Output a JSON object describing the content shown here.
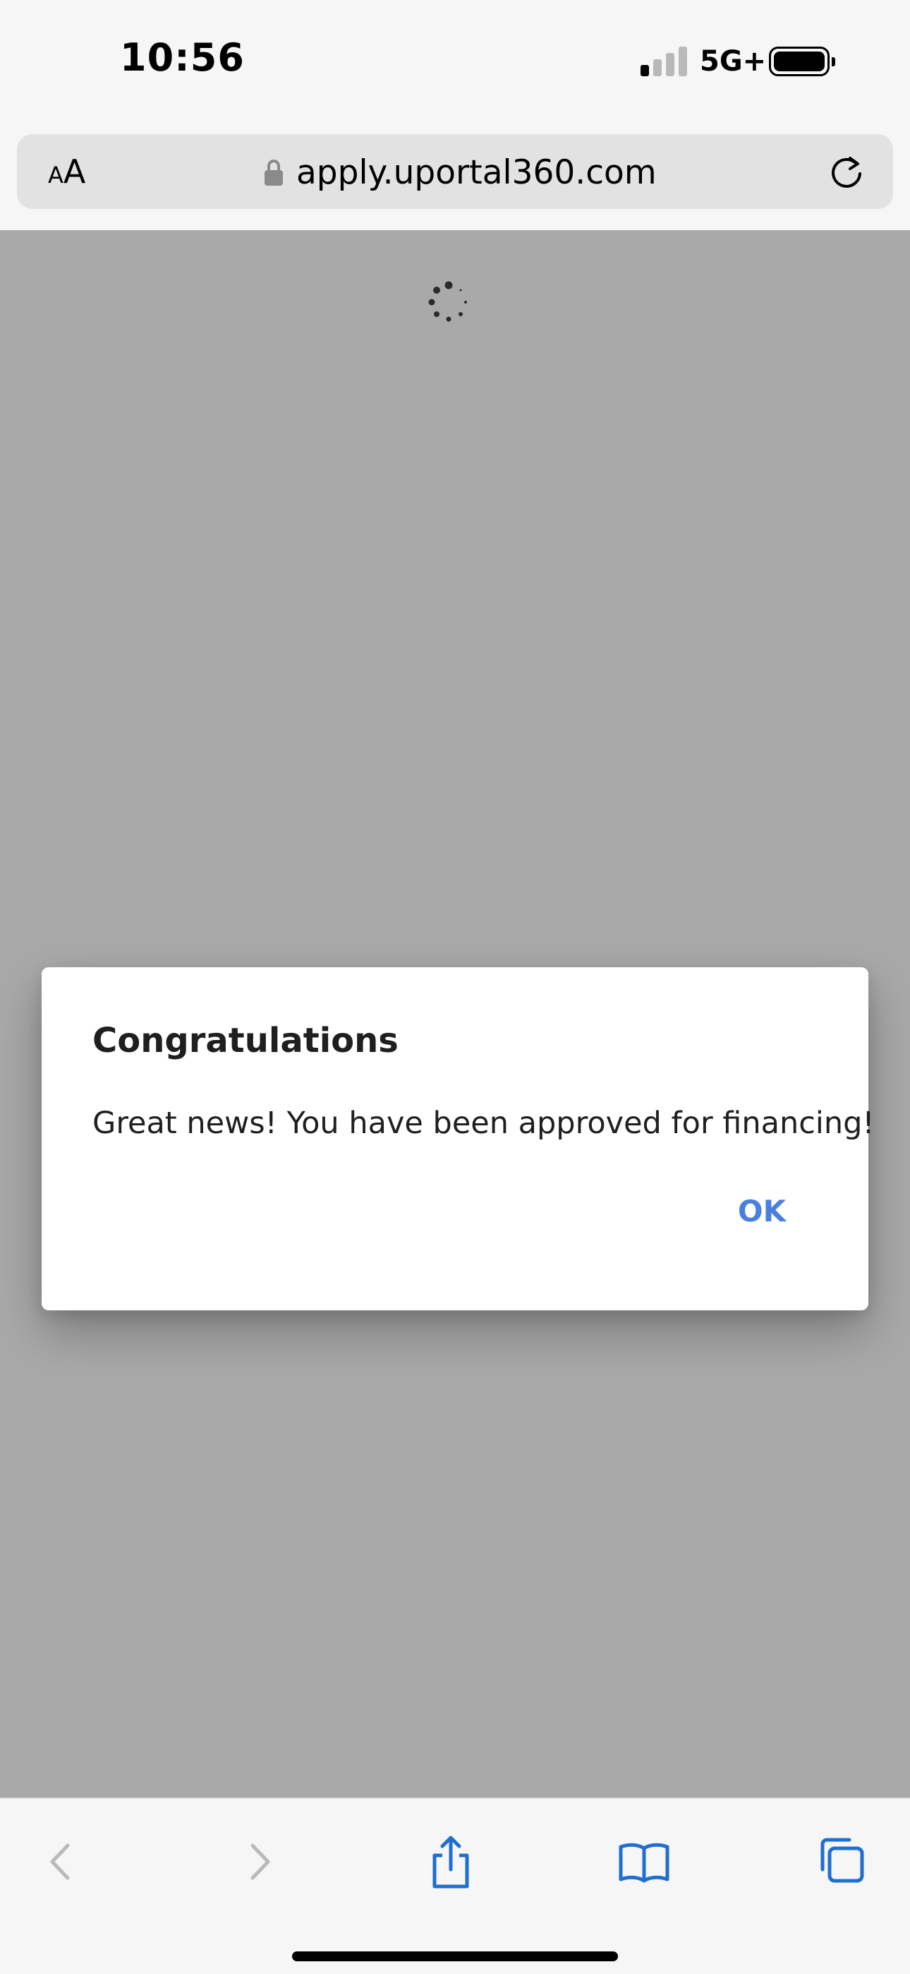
{
  "status_bar": {
    "time": "10:56",
    "network": "5G+",
    "signal_bars_active": 1,
    "signal_bars_total": 4,
    "battery_level": 1.0
  },
  "browser": {
    "text_size_small": "A",
    "text_size_large": "A",
    "url": "apply.uportal360.com",
    "icons": [
      "lock-icon",
      "reload-icon"
    ]
  },
  "dialog": {
    "title": "Congratulations",
    "message": "Great news! You have been approved for financing!",
    "ok_label": "OK"
  },
  "toolbar": {
    "icons": [
      "back-icon",
      "forward-icon",
      "share-icon",
      "bookmarks-icon",
      "tabs-icon"
    ]
  },
  "colors": {
    "overlay": "#a9a9a9",
    "accent": "#4a7fe0",
    "toolbar_blue": "#1f6fd1",
    "disabled": "#b9b9b9"
  }
}
